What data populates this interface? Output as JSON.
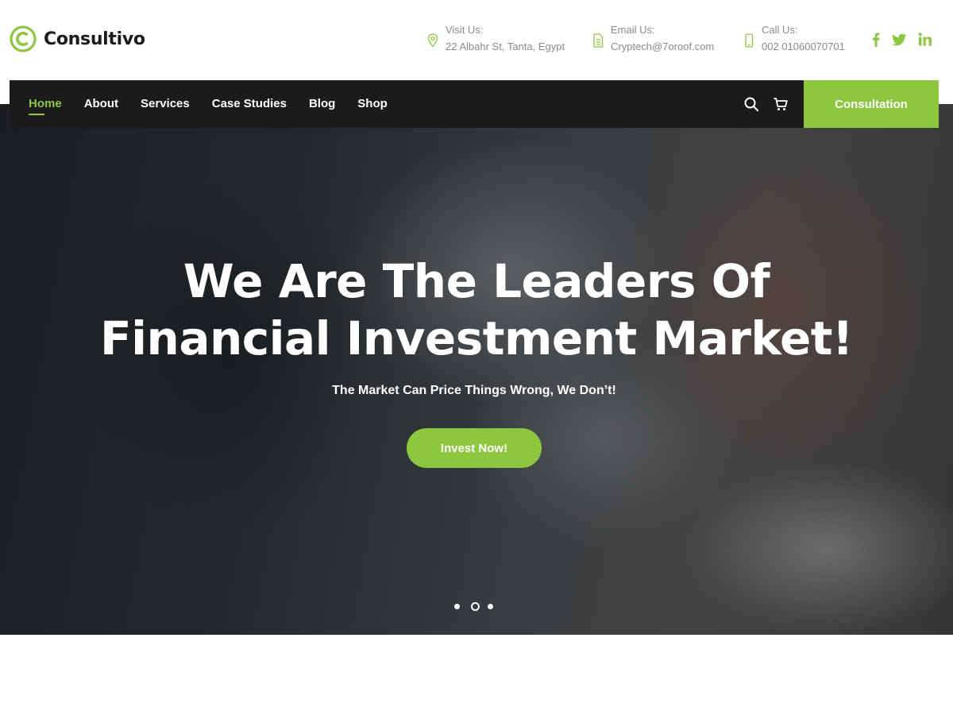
{
  "brand": {
    "name": "Consultivo",
    "accent": "#8dc63f",
    "icon": "consultivo-c-logo-icon"
  },
  "contacts": [
    {
      "label": "Visit Us:",
      "value": "22 Albahr St, Tanta, Egypt",
      "icon": "location-pin-icon"
    },
    {
      "label": "Email Us:",
      "value": "Cryptech@7oroof.com",
      "icon": "document-icon"
    },
    {
      "label": "Call Us:",
      "value": "002 01060070701",
      "icon": "mobile-phone-icon"
    }
  ],
  "social": [
    "facebook-icon",
    "twitter-icon",
    "linkedin-icon"
  ],
  "nav": {
    "items": [
      {
        "label": "Home",
        "active": true
      },
      {
        "label": "About"
      },
      {
        "label": "Services"
      },
      {
        "label": "Case Studies"
      },
      {
        "label": "Blog"
      },
      {
        "label": "Shop"
      }
    ],
    "icons": [
      "search-icon",
      "cart-icon"
    ],
    "cta_label": "Consultation"
  },
  "hero": {
    "title_line1": "We Are The Leaders Of",
    "title_line2": "Financial Investment Market!",
    "subtitle": "The Market Can Price Things Wrong, We Don’t!",
    "button_label": "Invest Now!",
    "slides": 3,
    "active_slide": 2
  }
}
